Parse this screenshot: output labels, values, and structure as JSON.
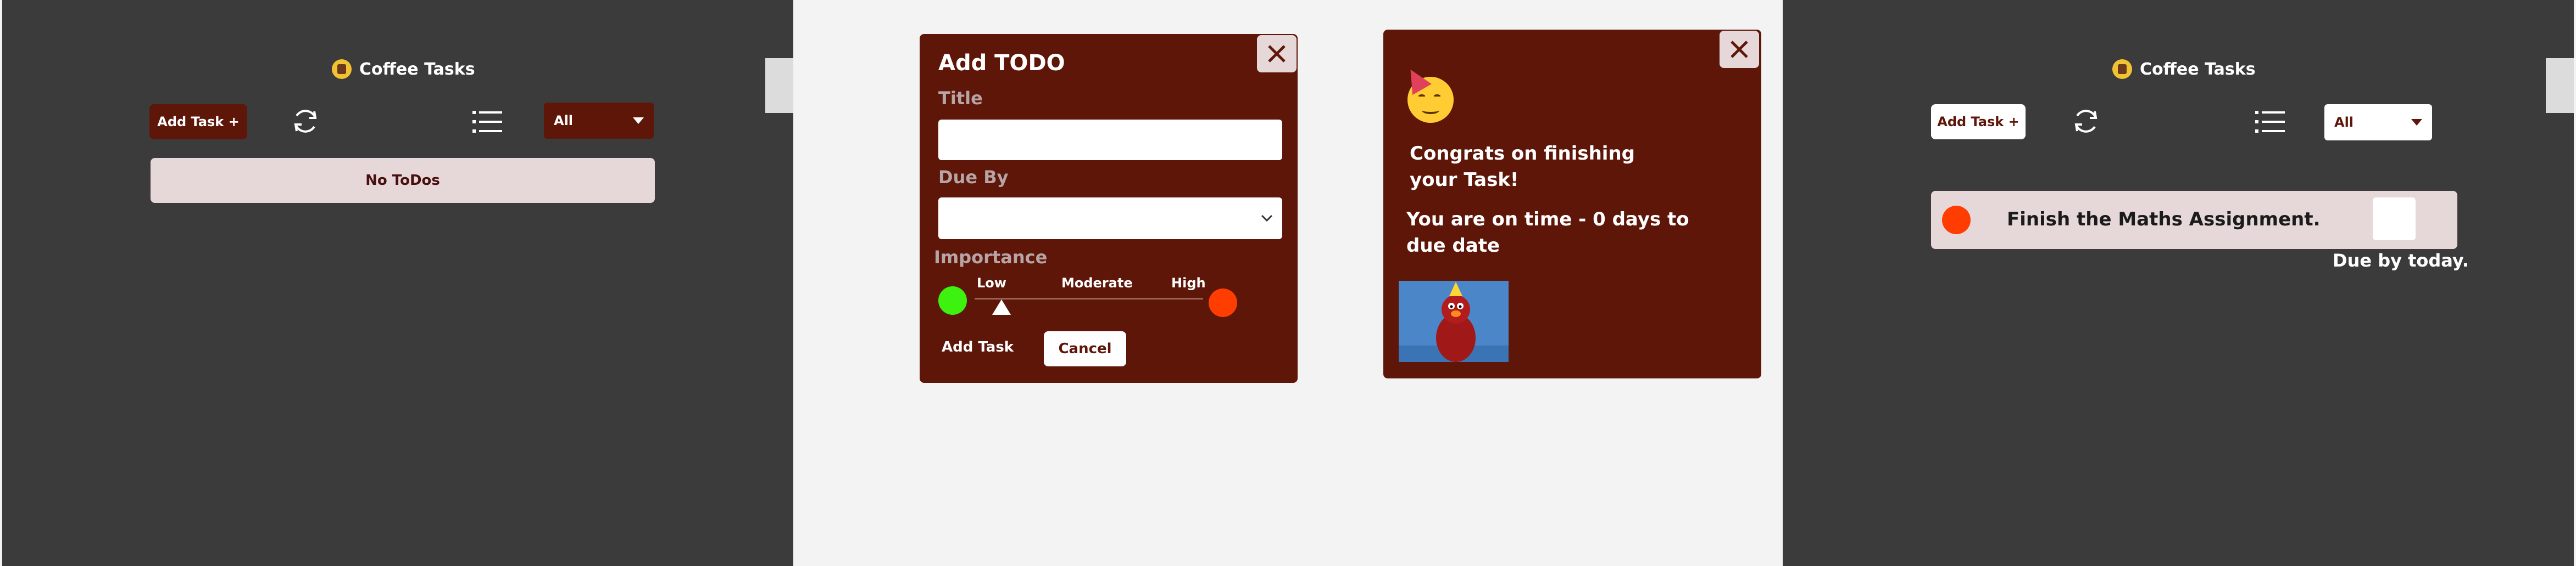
{
  "app": {
    "title": "Coffee Tasks",
    "add_task_label": "Add Task +",
    "filter_value": "All",
    "empty_message": "No ToDos"
  },
  "add_dialog": {
    "title": "Add TODO",
    "title_label": "Title",
    "title_value": "",
    "due_label": "Due By",
    "due_value": "",
    "importance_label": "Importance",
    "levels": [
      "Low",
      "Moderate",
      "High"
    ],
    "selected_level": "Low",
    "add_label": "Add Task",
    "cancel_label": "Cancel",
    "low_color": "#3df20f",
    "high_color": "#ff3d00"
  },
  "congrats_dialog": {
    "line1": "Congrats on finishing",
    "line2": "your Task!",
    "line3": "You are on time - 0 days to",
    "line4": "due date"
  },
  "task_list": {
    "tasks": [
      {
        "title": "Finish the Maths Assignment.",
        "due": "Due by today.",
        "importance_color": "#ff3d00"
      }
    ]
  },
  "colors": {
    "accent": "#5e1609",
    "background": "#3b3b3b",
    "row": "#e6d8d8"
  },
  "icons": [
    "logo-icon",
    "refresh-icon",
    "list-icon",
    "close-icon",
    "chevron-down-icon",
    "party-face-icon"
  ]
}
